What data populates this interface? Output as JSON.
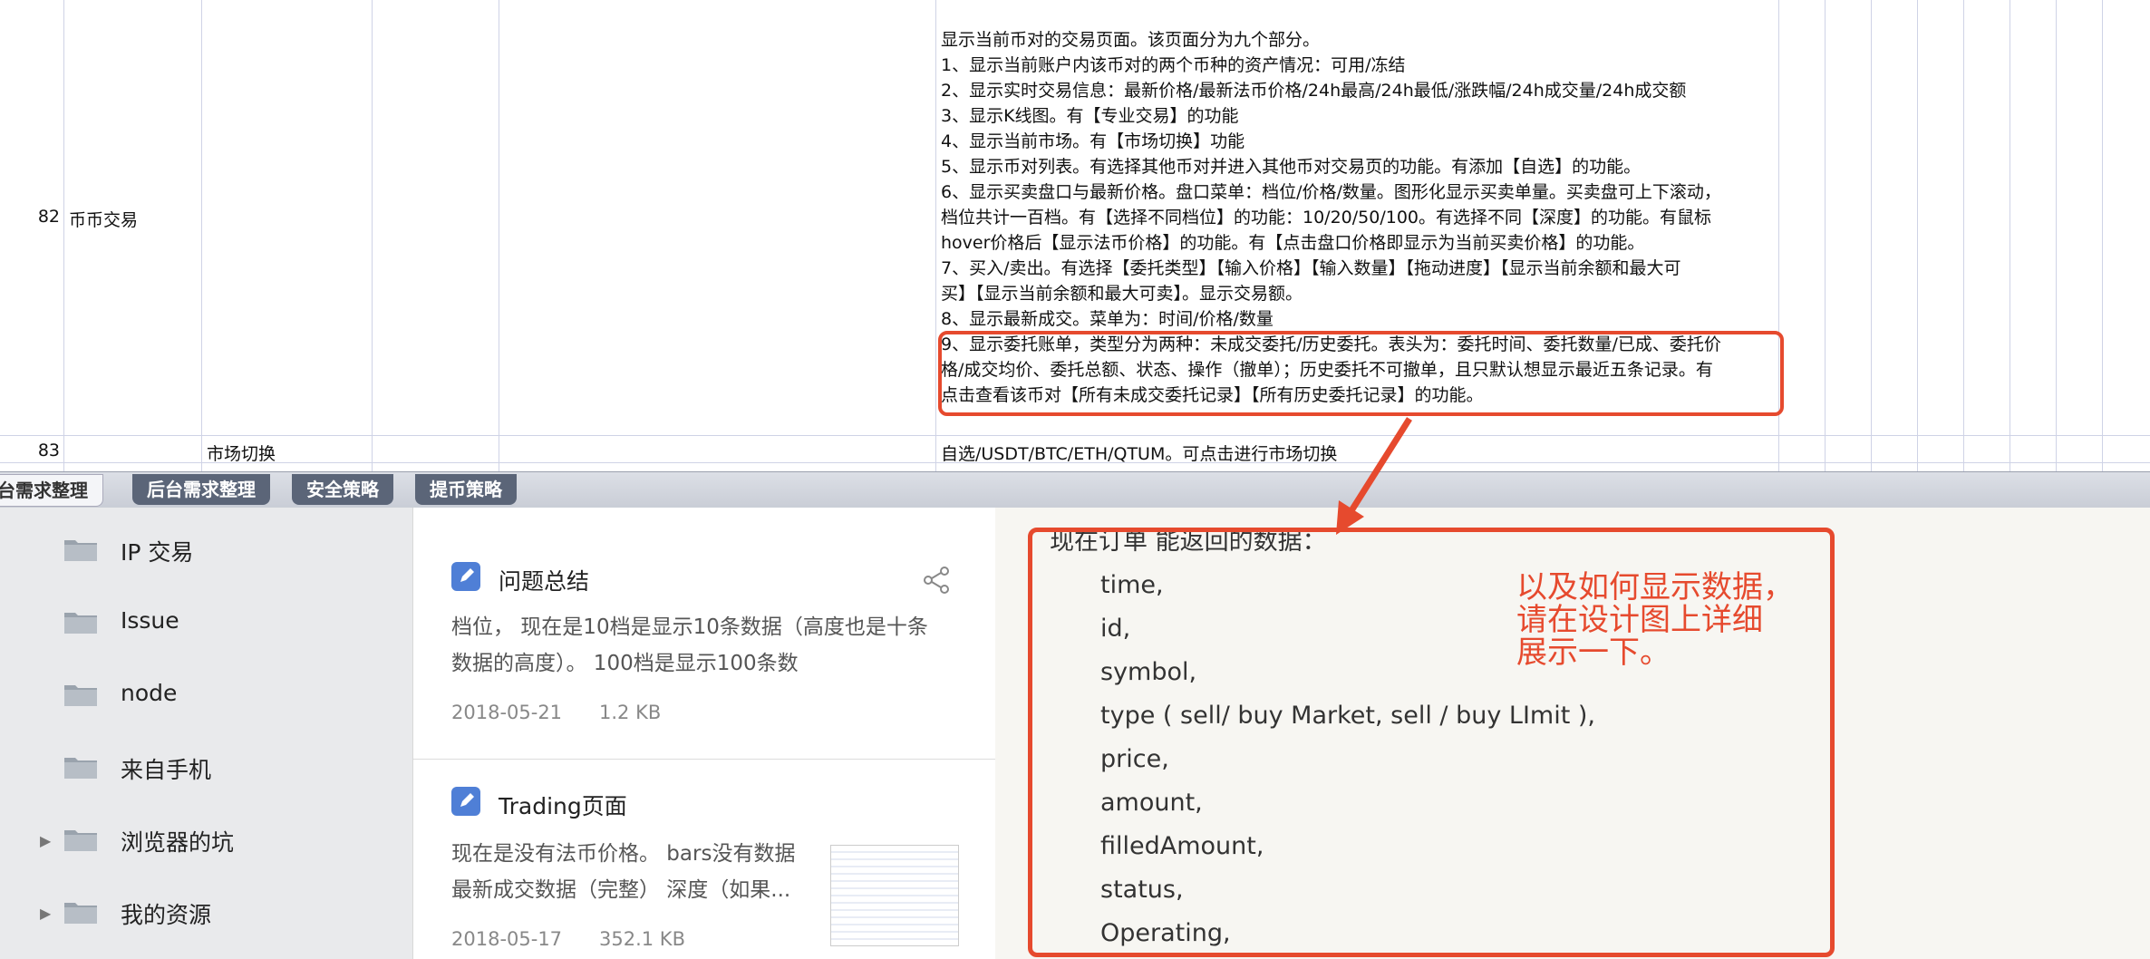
{
  "sheet": {
    "rows": [
      {
        "num": "82",
        "name": "币币交易"
      },
      {
        "num": "83",
        "sub": "市场切换",
        "desc": "自选/USDT/BTC/ETH/QTUM。可点击进行市场切换"
      }
    ],
    "desc_lines": [
      "显示当前币对的交易页面。该页面分为九个部分。",
      "1、显示当前账户内该币对的两个币种的资产情况：可用/冻结",
      "2、显示实时交易信息：最新价格/最新法币价格/24h最高/24h最低/涨跌幅/24h成交量/24h成交额",
      "3、显示K线图。有【专业交易】的功能",
      "4、显示当前市场。有【市场切换】功能",
      "5、显示币对列表。有选择其他币对并进入其他币对交易页的功能。有添加【自选】的功能。",
      "6、显示买卖盘口与最新价格。盘口菜单：档位/价格/数量。图形化显示买卖单量。买卖盘可上下滚动，",
      "档位共计一百档。有【选择不同档位】的功能：10/20/50/100。有选择不同【深度】的功能。有鼠标",
      "hover价格后【显示法币价格】的功能。有【点击盘口价格即显示为当前买卖价格】的功能。",
      "7、买入/卖出。有选择【委托类型】【输入价格】【输入数量】【拖动进度】【显示当前余额和最大可",
      "买】【显示当前余额和最大可卖】。显示交易额。",
      "8、显示最新成交。菜单为：时间/价格/数量",
      "9、显示委托账单，类型分为两种：未成交委托/历史委托。表头为：委托时间、委托数量/已成、委托价",
      "格/成交均价、委托总额、状态、操作（撤单）；历史委托不可撤单，且只默认想显示最近五条记录。有",
      "点击查看该币对【所有未成交委托记录】【所有历史委托记录】的功能。"
    ]
  },
  "tabs": [
    "前台需求整理",
    "后台需求整理",
    "安全策略",
    "提币策略"
  ],
  "sidebar": {
    "folders": [
      {
        "label": "IP 交易",
        "expandable": false
      },
      {
        "label": "Issue",
        "expandable": false
      },
      {
        "label": "node",
        "expandable": false
      },
      {
        "label": "来自手机",
        "expandable": false
      },
      {
        "label": "浏览器的坑",
        "expandable": true
      },
      {
        "label": "我的资源",
        "expandable": true
      }
    ]
  },
  "notes": [
    {
      "title": "问题总结",
      "snippet": [
        "档位， 现在是10档是显示10条数据（高度也是十条",
        "数据的高度）。 100档是显示100条数"
      ],
      "date": "2018-05-21",
      "size": "1.2 KB"
    },
    {
      "title": "Trading页面",
      "snippet": [
        "现在是没有法币价格。 bars没有数据",
        "最新成交数据（完整） 深度（如果..."
      ],
      "date": "2018-05-17",
      "size": "352.1 KB"
    }
  ],
  "content": {
    "heading": "现在订单 能返回的数据：",
    "fields": [
      "time,",
      "id,",
      "symbol,",
      "type ( sell/ buy Market,  sell / buy LImit ),",
      "price,",
      "amount,",
      "filledAmount,",
      "status,",
      "Operating,"
    ],
    "annotation": [
      "以及如何显示数据，",
      "请在设计图上详细",
      "展示一下。"
    ]
  },
  "colors": {
    "annotation": "#e64a2e",
    "note_icon": "#4f7fd6",
    "tab_bg": "#5b6578"
  }
}
